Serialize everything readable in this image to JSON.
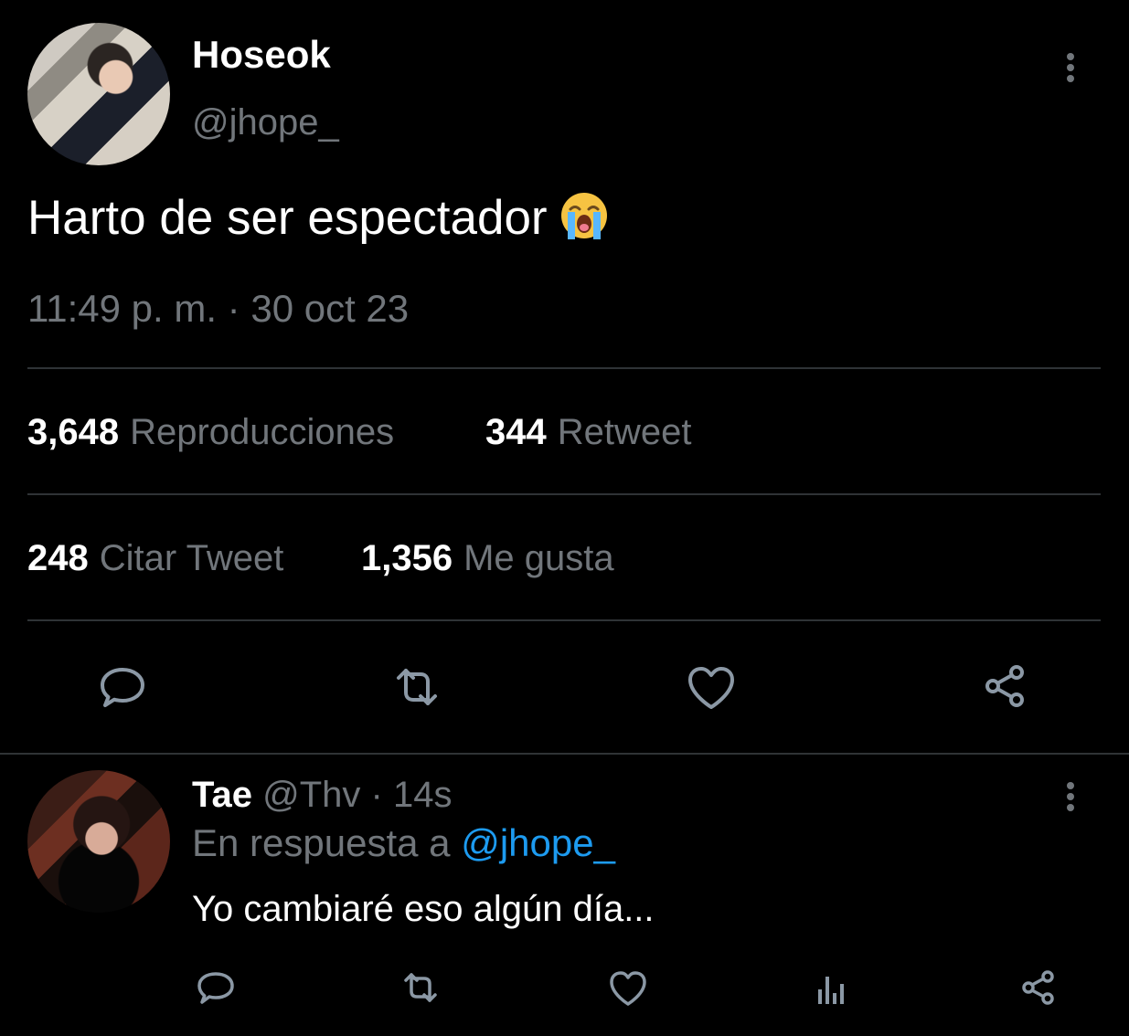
{
  "colors": {
    "background": "#000000",
    "text_primary": "#e7e9ea",
    "text_secondary": "#71767b",
    "link": "#1d9bf0",
    "divider": "#2f3336"
  },
  "main_tweet": {
    "author_name": "Hoseok",
    "author_handle": "@jhope_",
    "avatar_icon": "user-avatar-photo",
    "text": "Harto de ser espectador",
    "emoji_icon": "loudly-crying-face-emoji",
    "timestamp": "11:49 p. m. · 30 oct 23",
    "stats": [
      {
        "value": "3,648",
        "label": "Reproducciones"
      },
      {
        "value": "344",
        "label": "Retweet"
      },
      {
        "value": "248",
        "label": "Citar Tweet"
      },
      {
        "value": "1,356",
        "label": "Me gusta"
      }
    ],
    "actions": [
      "reply-icon",
      "retweet-icon",
      "like-icon",
      "share-icon"
    ]
  },
  "reply_tweet": {
    "author_name": "Tae",
    "author_handle": "@Thv",
    "time": "· 14s",
    "replying_to_label": "En respuesta a",
    "replying_to_handle": "@jhope_",
    "text": "Yo cambiaré eso algún día...",
    "actions": [
      "reply-icon",
      "retweet-icon",
      "like-icon",
      "analytics-icon",
      "share-icon"
    ]
  }
}
